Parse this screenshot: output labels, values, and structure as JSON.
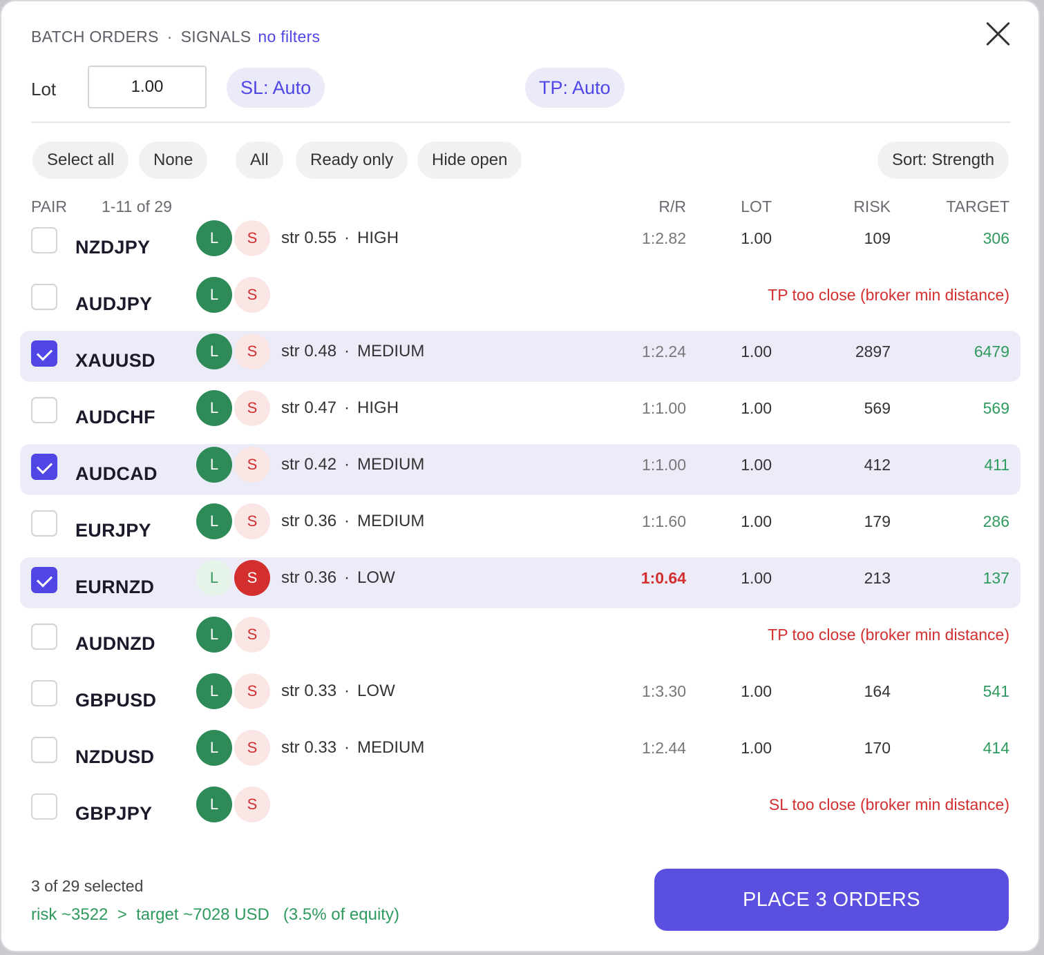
{
  "header": {
    "title": "BATCH ORDERS",
    "section": "SIGNALS",
    "filter_state": "no filters"
  },
  "lot": {
    "label": "Lot",
    "value": "1.00"
  },
  "sl_label": "SL: Auto",
  "tp_label": "TP: Auto",
  "filters": {
    "select_all": "Select all",
    "none": "None",
    "all": "All",
    "ready_only": "Ready only",
    "hide_open": "Hide open",
    "sort": "Sort: Strength"
  },
  "columns": {
    "pair": "PAIR",
    "range": "1-11 of 29",
    "rr": "R/R",
    "lot": "LOT",
    "risk": "RISK",
    "target": "TARGET"
  },
  "rows": [
    {
      "pair": "NZDJPY",
      "selected": false,
      "long": "L",
      "short": "S",
      "side": "long",
      "str": "str 0.55",
      "level": "HIGH",
      "rr": "1:2.82",
      "rr_bad": false,
      "lot": "1.00",
      "risk": "109",
      "target": "306",
      "error": ""
    },
    {
      "pair": "AUDJPY",
      "selected": false,
      "long": "L",
      "short": "S",
      "side": "long",
      "str": "",
      "level": "",
      "rr": "",
      "rr_bad": false,
      "lot": "",
      "risk": "",
      "target": "",
      "error": "TP too close (broker min distance)"
    },
    {
      "pair": "XAUUSD",
      "selected": true,
      "long": "L",
      "short": "S",
      "side": "long",
      "str": "str 0.48",
      "level": "MEDIUM",
      "rr": "1:2.24",
      "rr_bad": false,
      "lot": "1.00",
      "risk": "2897",
      "target": "6479",
      "error": ""
    },
    {
      "pair": "AUDCHF",
      "selected": false,
      "long": "L",
      "short": "S",
      "side": "long",
      "str": "str 0.47",
      "level": "HIGH",
      "rr": "1:1.00",
      "rr_bad": false,
      "lot": "1.00",
      "risk": "569",
      "target": "569",
      "error": ""
    },
    {
      "pair": "AUDCAD",
      "selected": true,
      "long": "L",
      "short": "S",
      "side": "long",
      "str": "str 0.42",
      "level": "MEDIUM",
      "rr": "1:1.00",
      "rr_bad": false,
      "lot": "1.00",
      "risk": "412",
      "target": "411",
      "error": ""
    },
    {
      "pair": "EURJPY",
      "selected": false,
      "long": "L",
      "short": "S",
      "side": "long",
      "str": "str 0.36",
      "level": "MEDIUM",
      "rr": "1:1.60",
      "rr_bad": false,
      "lot": "1.00",
      "risk": "179",
      "target": "286",
      "error": ""
    },
    {
      "pair": "EURNZD",
      "selected": true,
      "long": "L",
      "short": "S",
      "side": "short",
      "str": "str 0.36",
      "level": "LOW",
      "rr": "1:0.64",
      "rr_bad": true,
      "lot": "1.00",
      "risk": "213",
      "target": "137",
      "error": ""
    },
    {
      "pair": "AUDNZD",
      "selected": false,
      "long": "L",
      "short": "S",
      "side": "long",
      "str": "",
      "level": "",
      "rr": "",
      "rr_bad": false,
      "lot": "",
      "risk": "",
      "target": "",
      "error": "TP too close (broker min distance)"
    },
    {
      "pair": "GBPUSD",
      "selected": false,
      "long": "L",
      "short": "S",
      "side": "long",
      "str": "str 0.33",
      "level": "LOW",
      "rr": "1:3.30",
      "rr_bad": false,
      "lot": "1.00",
      "risk": "164",
      "target": "541",
      "error": ""
    },
    {
      "pair": "NZDUSD",
      "selected": false,
      "long": "L",
      "short": "S",
      "side": "long",
      "str": "str 0.33",
      "level": "MEDIUM",
      "rr": "1:2.44",
      "rr_bad": false,
      "lot": "1.00",
      "risk": "170",
      "target": "414",
      "error": ""
    },
    {
      "pair": "GBPJPY",
      "selected": false,
      "long": "L",
      "short": "S",
      "side": "long",
      "str": "",
      "level": "",
      "rr": "",
      "rr_bad": false,
      "lot": "",
      "risk": "",
      "target": "",
      "error": "SL too close (broker min distance)"
    }
  ],
  "footer": {
    "count": "3 of 29 selected",
    "summary": "risk ~3522  >  target ~7028 USD   (3.5% of equity)",
    "place_label": "PLACE 3 ORDERS"
  },
  "colors": {
    "accent": "#5b4fe0",
    "long": "#2e8b57",
    "short": "#d32f2f",
    "target": "#2e9a5e"
  }
}
